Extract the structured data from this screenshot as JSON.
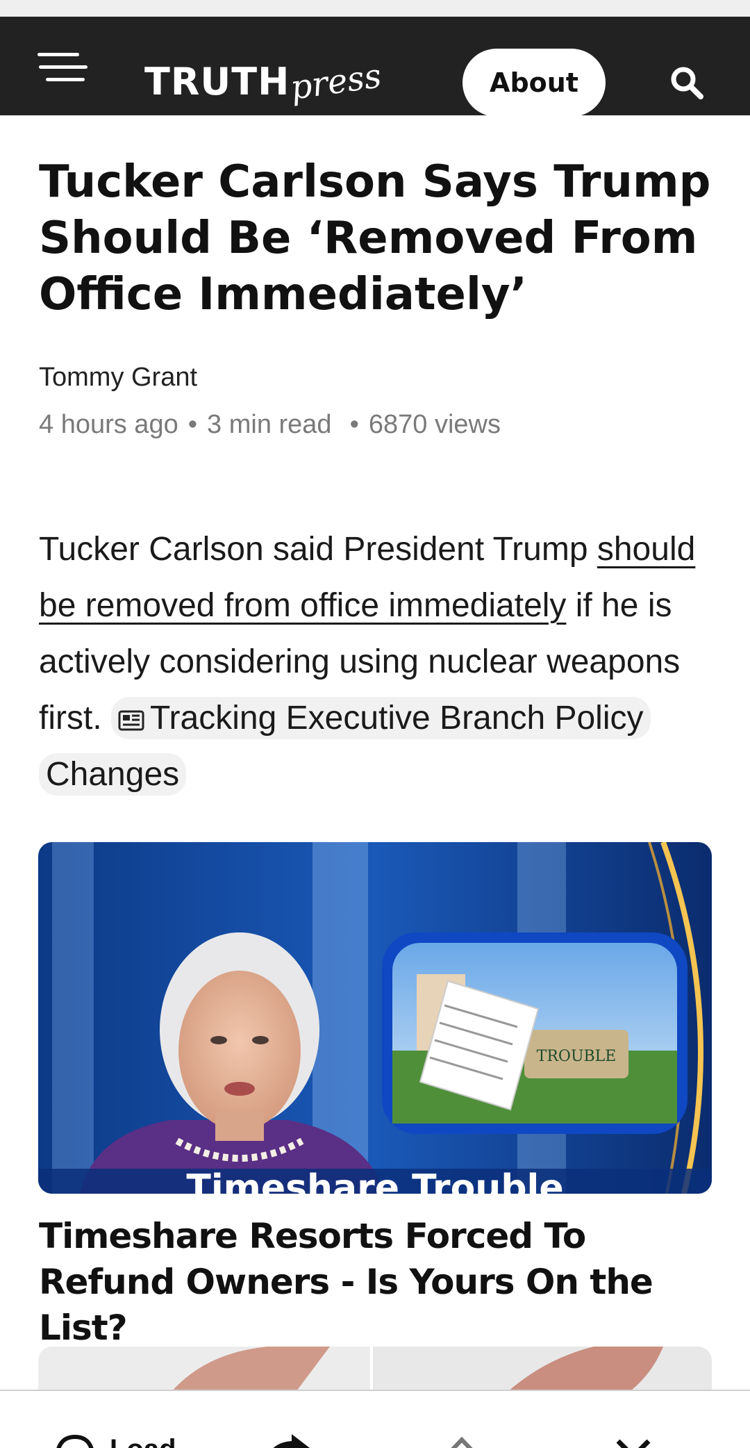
{
  "header": {
    "brand_main": "TRUTH",
    "brand_script": "press",
    "about_label": "About"
  },
  "article": {
    "headline": "Tucker Carlson Says Trump Should Be ‘Removed From Office Immediately’",
    "author": "Tommy Grant",
    "meta": {
      "time": "4 hours ago",
      "read": "3 min read",
      "views": "6870 views"
    },
    "lede": {
      "before": "Tucker Carlson said President Trump ",
      "link": "should be removed from office immediately",
      "after": " if he is actively considering using nuclear weapons first. ",
      "chip": "Tracking Executive Branch Policy Changes"
    }
  },
  "promo": {
    "image_caption": "Timeshare Trouble",
    "sign_text": "TROUBLE",
    "title": "Timeshare Resorts Forced To Refund Owners - Is Yours On the List?"
  },
  "bottom_bar": {
    "load_label": "Load"
  },
  "icons": {
    "menu": "hamburger-menu-icon",
    "search": "search-icon",
    "chip": "newspaper-icon",
    "comment": "comment-icon",
    "share": "share-icon",
    "up": "chevron-up-icon",
    "close": "close-icon"
  },
  "colors": {
    "header_bg": "#222222",
    "meta_text": "#7a7a7a",
    "chip_bg": "#f1f1f1"
  }
}
